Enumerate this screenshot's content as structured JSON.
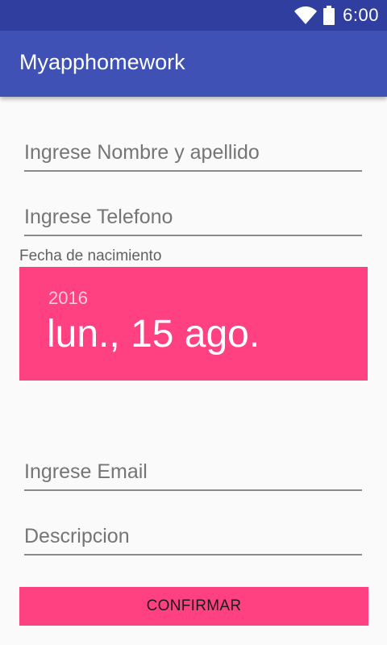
{
  "status_bar": {
    "time": "6:00",
    "icons": [
      "wifi-icon",
      "battery-icon"
    ]
  },
  "app_bar": {
    "title": "Myapphomework"
  },
  "form": {
    "name_placeholder": "Ingrese Nombre y apellido",
    "phone_placeholder": "Ingrese Telefono",
    "dob_label": "Fecha de nacimiento",
    "date_picker": {
      "year": "2016",
      "date": "lun., 15 ago."
    },
    "email_placeholder": "Ingrese Email",
    "description_placeholder": "Descripcion",
    "confirm_label": "CONFIRMAR"
  },
  "colors": {
    "status_bar": "#303f9f",
    "primary": "#3f51b5",
    "accent": "#ff4081",
    "background": "#fafafa"
  }
}
